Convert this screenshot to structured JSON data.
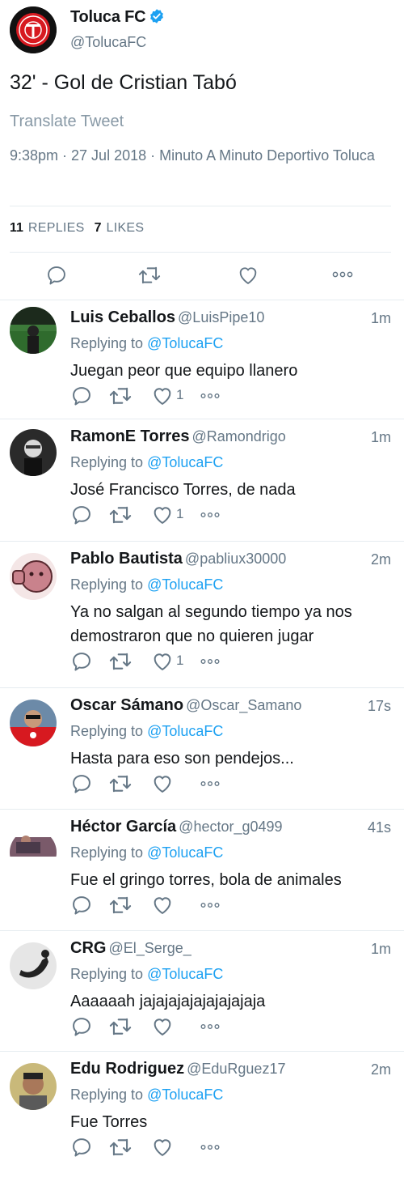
{
  "main_tweet": {
    "name": "Toluca FC",
    "handle": "@TolucaFC",
    "text": "32' - Gol de Cristian Tabó",
    "translate_label": "Translate Tweet",
    "meta": "9:38pm · 27 Jul 2018 · Minuto A Minuto Deportivo Toluca",
    "replies_count": "11",
    "replies_label": "REPLIES",
    "likes_count": "7",
    "likes_label": "LIKES"
  },
  "replying_label": "Replying to",
  "colors": {
    "accent": "#1da1f2",
    "secondary_text": "#657786",
    "divider": "#e6ecf0",
    "club_red": "#d71920"
  },
  "replies": [
    {
      "name": "Luis Ceballos",
      "handle": "@LuisPipe10",
      "time": "1m",
      "mention": "@TolucaFC",
      "text": "Juegan peor que equipo llanero",
      "likes": "1"
    },
    {
      "name": "RamonE Torres",
      "handle": "@Ramondrigo",
      "time": "1m",
      "mention": "@TolucaFC",
      "text": "José Francisco Torres, de nada",
      "likes": "1"
    },
    {
      "name": "Pablo Bautista",
      "handle": "@pabliux30000",
      "time": "2m",
      "mention": "@TolucaFC",
      "text": "Ya no salgan al segundo tiempo ya nos demostraron que no quieren jugar",
      "likes": "1"
    },
    {
      "name": "Oscar Sámano",
      "handle": "@Oscar_Samano",
      "time": "17s",
      "mention": "@TolucaFC",
      "text": "Hasta para eso son pendejos...",
      "likes": ""
    },
    {
      "name": "Héctor García",
      "handle": "@hector_g0499",
      "time": "41s",
      "mention": "@TolucaFC",
      "text": "Fue el gringo torres, bola de animales",
      "likes": ""
    },
    {
      "name": "CRG",
      "handle": "@El_Serge_",
      "time": "1m",
      "mention": "@TolucaFC",
      "text": "Aaaaaah jajajajajajajajajaja",
      "likes": ""
    },
    {
      "name": "Edu Rodriguez",
      "handle": "@EduRguez17",
      "time": "2m",
      "mention": "@TolucaFC",
      "text": "Fue Torres",
      "likes": ""
    }
  ]
}
